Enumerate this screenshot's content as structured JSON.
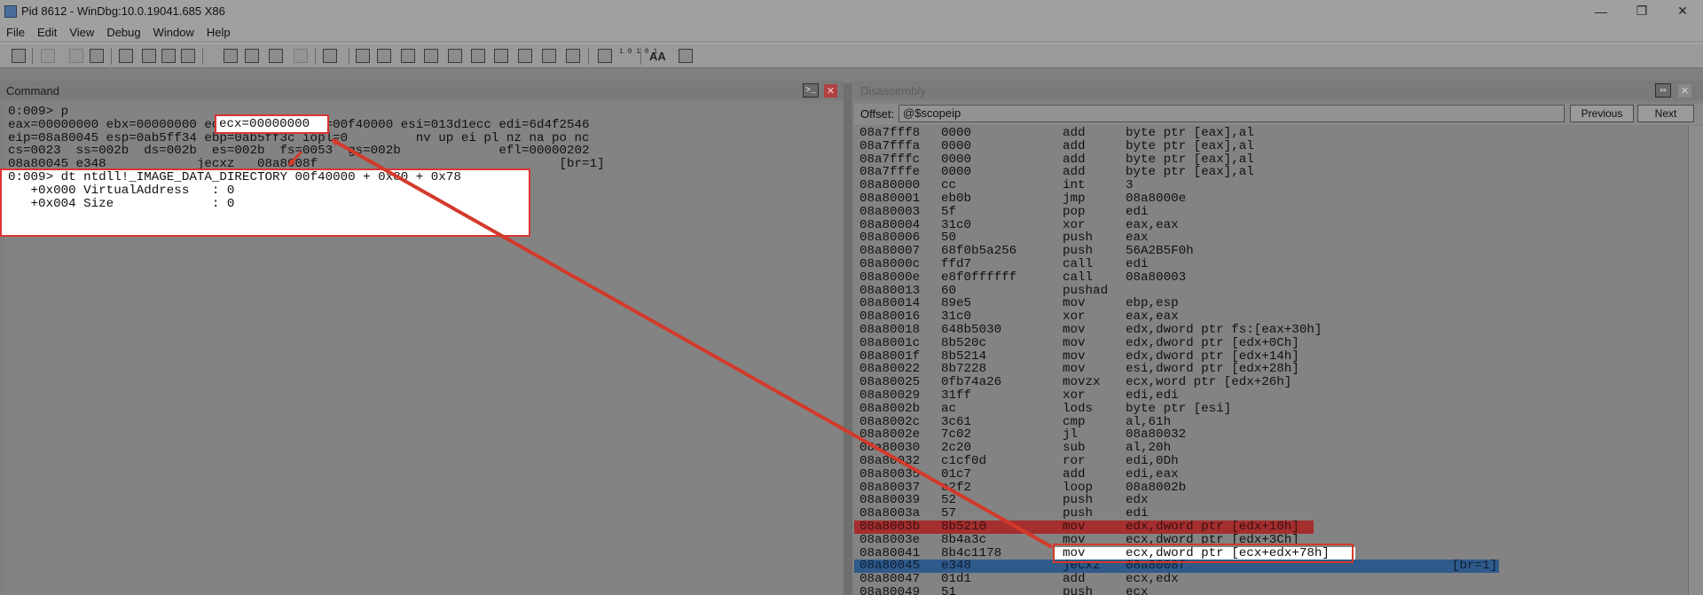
{
  "window": {
    "title": "Pid 8612 - WinDbg:10.0.19041.685 X86",
    "controls": [
      "—",
      "❐",
      "✕"
    ]
  },
  "menu": [
    "File",
    "Edit",
    "View",
    "Debug",
    "Window",
    "Help"
  ],
  "toolbar": {
    "font_icon_label": "AA",
    "nums_icon_label": "1 0\n1 0 1"
  },
  "command": {
    "title": "Command",
    "output": [
      "0:009> p",
      "eax=00000000 ebx=00000000 ecx=00000000 edx=00f40000 esi=013d1ecc edi=6d4f2546",
      "eip=08a80045 esp=0ab5ff34 ebp=0ab5ff3c iopl=0         nv up ei pl nz na po nc",
      "cs=0023  ss=002b  ds=002b  es=002b  fs=0053  gs=002b             efl=00000202",
      "08a80045 e348            jecxz   08a8008f                                [br=1]"
    ],
    "highlight_register": "ecx=00000000",
    "dt_output": [
      "0:009> dt ntdll!_IMAGE_DATA_DIRECTORY 00f40000 + 0x80 + 0x78",
      "   +0x000 VirtualAddress   : 0",
      "   +0x004 Size             : 0"
    ]
  },
  "disassembly": {
    "title": "Disassembly",
    "offset_label": "Offset:",
    "offset_value": "@$scopeip",
    "previous_label": "Previous",
    "next_label": "Next",
    "rows": [
      {
        "addr": "08a7fff8",
        "bytes": "0000",
        "mn": "add",
        "op": "byte ptr [eax],al"
      },
      {
        "addr": "08a7fffa",
        "bytes": "0000",
        "mn": "add",
        "op": "byte ptr [eax],al"
      },
      {
        "addr": "08a7fffc",
        "bytes": "0000",
        "mn": "add",
        "op": "byte ptr [eax],al"
      },
      {
        "addr": "08a7fffe",
        "bytes": "0000",
        "mn": "add",
        "op": "byte ptr [eax],al"
      },
      {
        "addr": "08a80000",
        "bytes": "cc",
        "mn": "int",
        "op": "3"
      },
      {
        "addr": "08a80001",
        "bytes": "eb0b",
        "mn": "jmp",
        "op": "08a8000e"
      },
      {
        "addr": "08a80003",
        "bytes": "5f",
        "mn": "pop",
        "op": "edi"
      },
      {
        "addr": "08a80004",
        "bytes": "31c0",
        "mn": "xor",
        "op": "eax,eax"
      },
      {
        "addr": "08a80006",
        "bytes": "50",
        "mn": "push",
        "op": "eax"
      },
      {
        "addr": "08a80007",
        "bytes": "68f0b5a256",
        "mn": "push",
        "op": "56A2B5F0h"
      },
      {
        "addr": "08a8000c",
        "bytes": "ffd7",
        "mn": "call",
        "op": "edi"
      },
      {
        "addr": "08a8000e",
        "bytes": "e8f0ffffff",
        "mn": "call",
        "op": "08a80003"
      },
      {
        "addr": "08a80013",
        "bytes": "60",
        "mn": "pushad",
        "op": ""
      },
      {
        "addr": "08a80014",
        "bytes": "89e5",
        "mn": "mov",
        "op": "ebp,esp"
      },
      {
        "addr": "08a80016",
        "bytes": "31c0",
        "mn": "xor",
        "op": "eax,eax"
      },
      {
        "addr": "08a80018",
        "bytes": "648b5030",
        "mn": "mov",
        "op": "edx,dword ptr fs:[eax+30h]"
      },
      {
        "addr": "08a8001c",
        "bytes": "8b520c",
        "mn": "mov",
        "op": "edx,dword ptr [edx+0Ch]"
      },
      {
        "addr": "08a8001f",
        "bytes": "8b5214",
        "mn": "mov",
        "op": "edx,dword ptr [edx+14h]"
      },
      {
        "addr": "08a80022",
        "bytes": "8b7228",
        "mn": "mov",
        "op": "esi,dword ptr [edx+28h]"
      },
      {
        "addr": "08a80025",
        "bytes": "0fb74a26",
        "mn": "movzx",
        "op": "ecx,word ptr [edx+26h]"
      },
      {
        "addr": "08a80029",
        "bytes": "31ff",
        "mn": "xor",
        "op": "edi,edi"
      },
      {
        "addr": "08a8002b",
        "bytes": "ac",
        "mn": "lods",
        "op": "byte ptr [esi]"
      },
      {
        "addr": "08a8002c",
        "bytes": "3c61",
        "mn": "cmp",
        "op": "al,61h"
      },
      {
        "addr": "08a8002e",
        "bytes": "7c02",
        "mn": "jl",
        "op": "08a80032"
      },
      {
        "addr": "08a80030",
        "bytes": "2c20",
        "mn": "sub",
        "op": "al,20h"
      },
      {
        "addr": "08a80032",
        "bytes": "c1cf0d",
        "mn": "ror",
        "op": "edi,0Dh"
      },
      {
        "addr": "08a80035",
        "bytes": "01c7",
        "mn": "add",
        "op": "edi,eax"
      },
      {
        "addr": "08a80037",
        "bytes": "e2f2",
        "mn": "loop",
        "op": "08a8002b"
      },
      {
        "addr": "08a80039",
        "bytes": "52",
        "mn": "push",
        "op": "edx"
      },
      {
        "addr": "08a8003a",
        "bytes": "57",
        "mn": "push",
        "op": "edi"
      },
      {
        "addr": "08a8003b",
        "bytes": "8b5210",
        "mn": "mov",
        "op": "edx,dword ptr [edx+10h]",
        "state": "breakpoint"
      },
      {
        "addr": "08a8003e",
        "bytes": "8b4a3c",
        "mn": "mov",
        "op": "ecx,dword ptr [edx+3Ch]"
      },
      {
        "addr": "08a80041",
        "bytes": "8b4c1178",
        "mn": "mov",
        "op": "ecx,dword ptr [ecx+edx+78h]",
        "state": "callout"
      },
      {
        "addr": "08a80045",
        "bytes": "e348",
        "mn": "jecxz",
        "op": "08a8008f",
        "extra": "[br=1]",
        "state": "current"
      },
      {
        "addr": "08a80047",
        "bytes": "01d1",
        "mn": "add",
        "op": "ecx,edx"
      },
      {
        "addr": "08a80049",
        "bytes": "51",
        "mn": "push",
        "op": "ecx"
      }
    ]
  },
  "colors": {
    "annotation": "#d33a2a",
    "breakpoint_row": "#a52e2e",
    "current_row": "#2e5a8c"
  }
}
